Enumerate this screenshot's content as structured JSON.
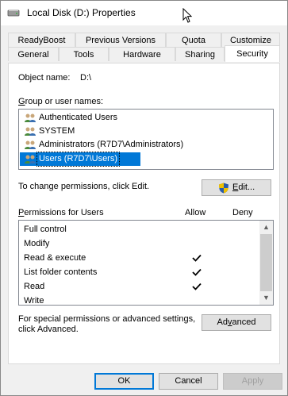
{
  "window": {
    "title": "Local Disk (D:) Properties"
  },
  "tabs_row1": [
    "ReadyBoost",
    "Previous Versions",
    "Quota",
    "Customize"
  ],
  "tabs_row2": [
    "General",
    "Tools",
    "Hardware",
    "Sharing",
    "Security"
  ],
  "active_tab": "Security",
  "object": {
    "label": "Object name:",
    "value": "D:\\"
  },
  "groups": {
    "label_prefix": "G",
    "label_rest": "roup or user names:",
    "items": [
      "Authenticated Users",
      "SYSTEM",
      "Administrators (R7D7\\Administrators)",
      "Users (R7D7\\Users)"
    ],
    "selected": "Users (R7D7\\Users)"
  },
  "change_text": "To change permissions, click Edit.",
  "edit_button": {
    "prefix": "E",
    "rest": "dit..."
  },
  "permissions": {
    "label_prefix": "P",
    "label_rest": "ermissions for Users",
    "allow_header": "Allow",
    "deny_header": "Deny",
    "rows": [
      {
        "name": "Full control",
        "allow": false
      },
      {
        "name": "Modify",
        "allow": false
      },
      {
        "name": "Read & execute",
        "allow": true
      },
      {
        "name": "List folder contents",
        "allow": true
      },
      {
        "name": "Read",
        "allow": true
      },
      {
        "name": "Write",
        "allow": false
      }
    ]
  },
  "advanced_text_line1": "For special permissions or advanced settings,",
  "advanced_text_line2": "click Advanced.",
  "advanced_button": {
    "prefix": "Ad",
    "u": "v",
    "rest": "anced"
  },
  "footer": {
    "ok": "OK",
    "cancel": "Cancel",
    "apply": "Apply"
  },
  "colors": {
    "selection": "#0078d7",
    "shield_blue": "#2a5caa",
    "shield_yellow": "#f0c000"
  }
}
